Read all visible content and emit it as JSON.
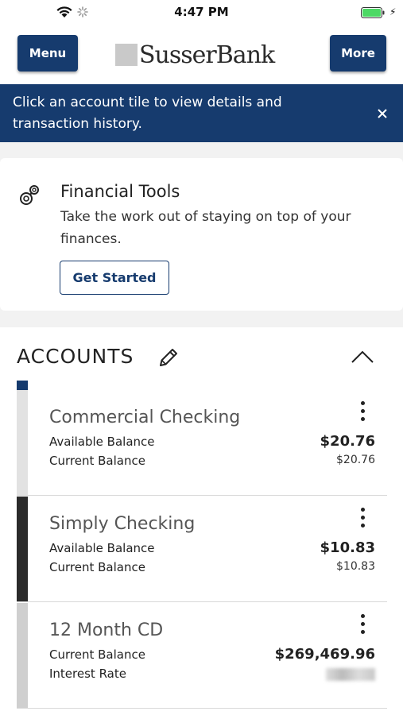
{
  "status_bar": {
    "time": "4:47 PM"
  },
  "header": {
    "menu_label": "Menu",
    "logo_text": "SusserBank",
    "more_label": "More"
  },
  "banner": {
    "text": "Click an account tile to view details and transaction history."
  },
  "financial_tools": {
    "title": "Financial Tools",
    "description": "Take the work out of staying on top of your finances.",
    "button_label": "Get Started"
  },
  "accounts": {
    "title": "ACCOUNTS",
    "items": [
      {
        "name": "Commercial Checking",
        "line1_label": "Available Balance",
        "line1_value": "$20.76",
        "line2_label": "Current Balance",
        "line2_value": "$20.76",
        "bar_color": "#e2e2e2"
      },
      {
        "name": "Simply Checking",
        "line1_label": "Available Balance",
        "line1_value": "$10.83",
        "line2_label": "Current Balance",
        "line2_value": "$10.83",
        "bar_color": "#2b2b2b"
      },
      {
        "name": "12 Month CD",
        "line1_label": "Current Balance",
        "line1_value": "$269,469.96",
        "line2_label": "Interest Rate",
        "line2_value": "",
        "bar_color": "#cfcfcf"
      }
    ]
  },
  "colors": {
    "brand_navy": "#163b6e",
    "battery_green": "#4cd964"
  }
}
